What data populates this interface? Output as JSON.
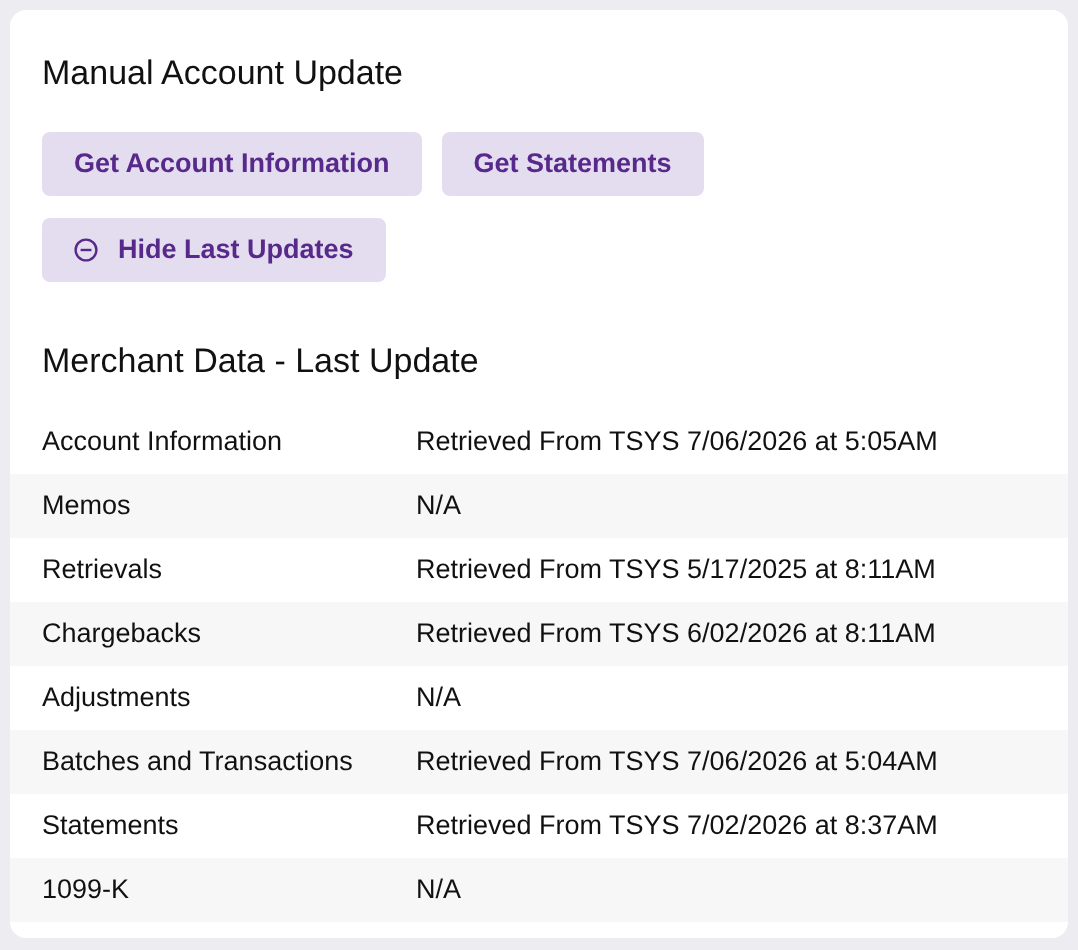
{
  "title": "Manual Account Update",
  "buttons": [
    {
      "label": "Get Account Information",
      "kind": "plain"
    },
    {
      "label": "Get Statements",
      "kind": "plain"
    },
    {
      "label": "Hide Last Updates",
      "kind": "toggle"
    }
  ],
  "section_title": "Merchant Data - Last Update",
  "rows": [
    {
      "name": "Account Information",
      "value": "Retrieved From TSYS 7/06/2026 at 5:05AM"
    },
    {
      "name": "Memos",
      "value": "N/A"
    },
    {
      "name": "Retrievals",
      "value": "Retrieved From TSYS 5/17/2025 at 8:11AM"
    },
    {
      "name": "Chargebacks",
      "value": "Retrieved From TSYS 6/02/2026 at 8:11AM"
    },
    {
      "name": "Adjustments",
      "value": "N/A"
    },
    {
      "name": "Batches and Transactions",
      "value": "Retrieved From TSYS 7/06/2026 at 5:04AM"
    },
    {
      "name": "Statements",
      "value": "Retrieved From TSYS 7/02/2026 at 8:37AM"
    },
    {
      "name": "1099-K",
      "value": "N/A"
    }
  ]
}
